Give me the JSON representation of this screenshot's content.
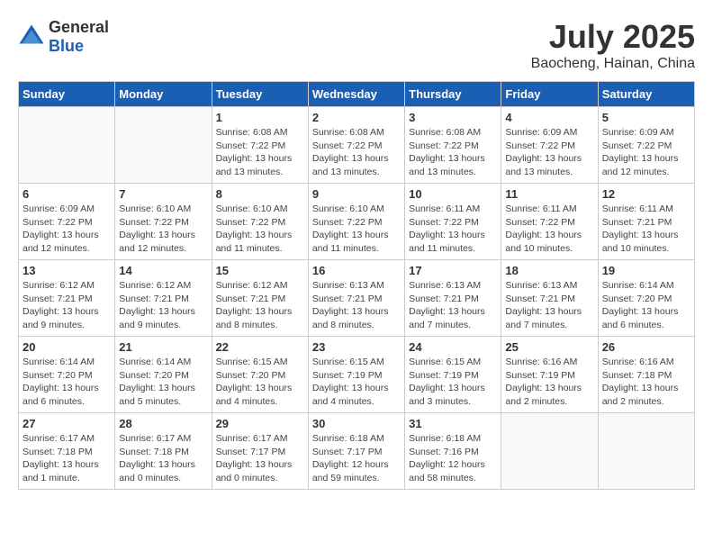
{
  "header": {
    "logo_general": "General",
    "logo_blue": "Blue",
    "month_year": "July 2025",
    "location": "Baocheng, Hainan, China"
  },
  "days_of_week": [
    "Sunday",
    "Monday",
    "Tuesday",
    "Wednesday",
    "Thursday",
    "Friday",
    "Saturday"
  ],
  "weeks": [
    [
      {
        "day": "",
        "info": ""
      },
      {
        "day": "",
        "info": ""
      },
      {
        "day": "1",
        "info": "Sunrise: 6:08 AM\nSunset: 7:22 PM\nDaylight: 13 hours\nand 13 minutes."
      },
      {
        "day": "2",
        "info": "Sunrise: 6:08 AM\nSunset: 7:22 PM\nDaylight: 13 hours\nand 13 minutes."
      },
      {
        "day": "3",
        "info": "Sunrise: 6:08 AM\nSunset: 7:22 PM\nDaylight: 13 hours\nand 13 minutes."
      },
      {
        "day": "4",
        "info": "Sunrise: 6:09 AM\nSunset: 7:22 PM\nDaylight: 13 hours\nand 13 minutes."
      },
      {
        "day": "5",
        "info": "Sunrise: 6:09 AM\nSunset: 7:22 PM\nDaylight: 13 hours\nand 12 minutes."
      }
    ],
    [
      {
        "day": "6",
        "info": "Sunrise: 6:09 AM\nSunset: 7:22 PM\nDaylight: 13 hours\nand 12 minutes."
      },
      {
        "day": "7",
        "info": "Sunrise: 6:10 AM\nSunset: 7:22 PM\nDaylight: 13 hours\nand 12 minutes."
      },
      {
        "day": "8",
        "info": "Sunrise: 6:10 AM\nSunset: 7:22 PM\nDaylight: 13 hours\nand 11 minutes."
      },
      {
        "day": "9",
        "info": "Sunrise: 6:10 AM\nSunset: 7:22 PM\nDaylight: 13 hours\nand 11 minutes."
      },
      {
        "day": "10",
        "info": "Sunrise: 6:11 AM\nSunset: 7:22 PM\nDaylight: 13 hours\nand 11 minutes."
      },
      {
        "day": "11",
        "info": "Sunrise: 6:11 AM\nSunset: 7:22 PM\nDaylight: 13 hours\nand 10 minutes."
      },
      {
        "day": "12",
        "info": "Sunrise: 6:11 AM\nSunset: 7:21 PM\nDaylight: 13 hours\nand 10 minutes."
      }
    ],
    [
      {
        "day": "13",
        "info": "Sunrise: 6:12 AM\nSunset: 7:21 PM\nDaylight: 13 hours\nand 9 minutes."
      },
      {
        "day": "14",
        "info": "Sunrise: 6:12 AM\nSunset: 7:21 PM\nDaylight: 13 hours\nand 9 minutes."
      },
      {
        "day": "15",
        "info": "Sunrise: 6:12 AM\nSunset: 7:21 PM\nDaylight: 13 hours\nand 8 minutes."
      },
      {
        "day": "16",
        "info": "Sunrise: 6:13 AM\nSunset: 7:21 PM\nDaylight: 13 hours\nand 8 minutes."
      },
      {
        "day": "17",
        "info": "Sunrise: 6:13 AM\nSunset: 7:21 PM\nDaylight: 13 hours\nand 7 minutes."
      },
      {
        "day": "18",
        "info": "Sunrise: 6:13 AM\nSunset: 7:21 PM\nDaylight: 13 hours\nand 7 minutes."
      },
      {
        "day": "19",
        "info": "Sunrise: 6:14 AM\nSunset: 7:20 PM\nDaylight: 13 hours\nand 6 minutes."
      }
    ],
    [
      {
        "day": "20",
        "info": "Sunrise: 6:14 AM\nSunset: 7:20 PM\nDaylight: 13 hours\nand 6 minutes."
      },
      {
        "day": "21",
        "info": "Sunrise: 6:14 AM\nSunset: 7:20 PM\nDaylight: 13 hours\nand 5 minutes."
      },
      {
        "day": "22",
        "info": "Sunrise: 6:15 AM\nSunset: 7:20 PM\nDaylight: 13 hours\nand 4 minutes."
      },
      {
        "day": "23",
        "info": "Sunrise: 6:15 AM\nSunset: 7:19 PM\nDaylight: 13 hours\nand 4 minutes."
      },
      {
        "day": "24",
        "info": "Sunrise: 6:15 AM\nSunset: 7:19 PM\nDaylight: 13 hours\nand 3 minutes."
      },
      {
        "day": "25",
        "info": "Sunrise: 6:16 AM\nSunset: 7:19 PM\nDaylight: 13 hours\nand 2 minutes."
      },
      {
        "day": "26",
        "info": "Sunrise: 6:16 AM\nSunset: 7:18 PM\nDaylight: 13 hours\nand 2 minutes."
      }
    ],
    [
      {
        "day": "27",
        "info": "Sunrise: 6:17 AM\nSunset: 7:18 PM\nDaylight: 13 hours\nand 1 minute."
      },
      {
        "day": "28",
        "info": "Sunrise: 6:17 AM\nSunset: 7:18 PM\nDaylight: 13 hours\nand 0 minutes."
      },
      {
        "day": "29",
        "info": "Sunrise: 6:17 AM\nSunset: 7:17 PM\nDaylight: 13 hours\nand 0 minutes."
      },
      {
        "day": "30",
        "info": "Sunrise: 6:18 AM\nSunset: 7:17 PM\nDaylight: 12 hours\nand 59 minutes."
      },
      {
        "day": "31",
        "info": "Sunrise: 6:18 AM\nSunset: 7:16 PM\nDaylight: 12 hours\nand 58 minutes."
      },
      {
        "day": "",
        "info": ""
      },
      {
        "day": "",
        "info": ""
      }
    ]
  ]
}
